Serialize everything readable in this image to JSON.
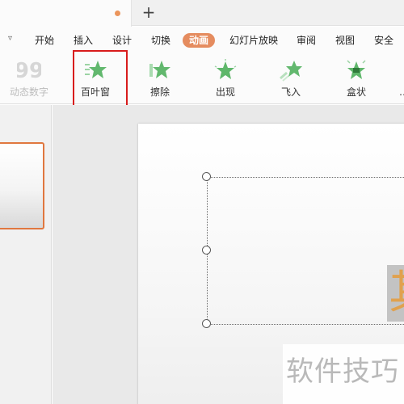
{
  "tabs": {
    "new_tab_symbol": "+"
  },
  "menu": {
    "collapse_symbol": "▿",
    "items": [
      "开始",
      "插入",
      "设计",
      "切换",
      "动画",
      "幻灯片放映",
      "审阅",
      "视图",
      "安全"
    ],
    "active_item": "动画"
  },
  "animations": {
    "items": [
      {
        "label": "动态数字",
        "icon": "dynamic-number-icon",
        "enabled": false
      },
      {
        "label": "百叶窗",
        "icon": "blinds-icon",
        "enabled": true,
        "highlighted": true
      },
      {
        "label": "擦除",
        "icon": "wipe-icon",
        "enabled": true
      },
      {
        "label": "出现",
        "icon": "appear-icon",
        "enabled": true
      },
      {
        "label": "飞入",
        "icon": "fly-in-icon",
        "enabled": true
      },
      {
        "label": "盒状",
        "icon": "box-icon",
        "enabled": true
      }
    ]
  },
  "slide": {
    "partial_character": "其"
  },
  "watermark": {
    "text": "软件技巧"
  },
  "colors": {
    "accent": "#e58c5f",
    "highlight_border": "#d81c1c",
    "star_green": "#62b86e",
    "thumb_border": "#e0773f"
  }
}
